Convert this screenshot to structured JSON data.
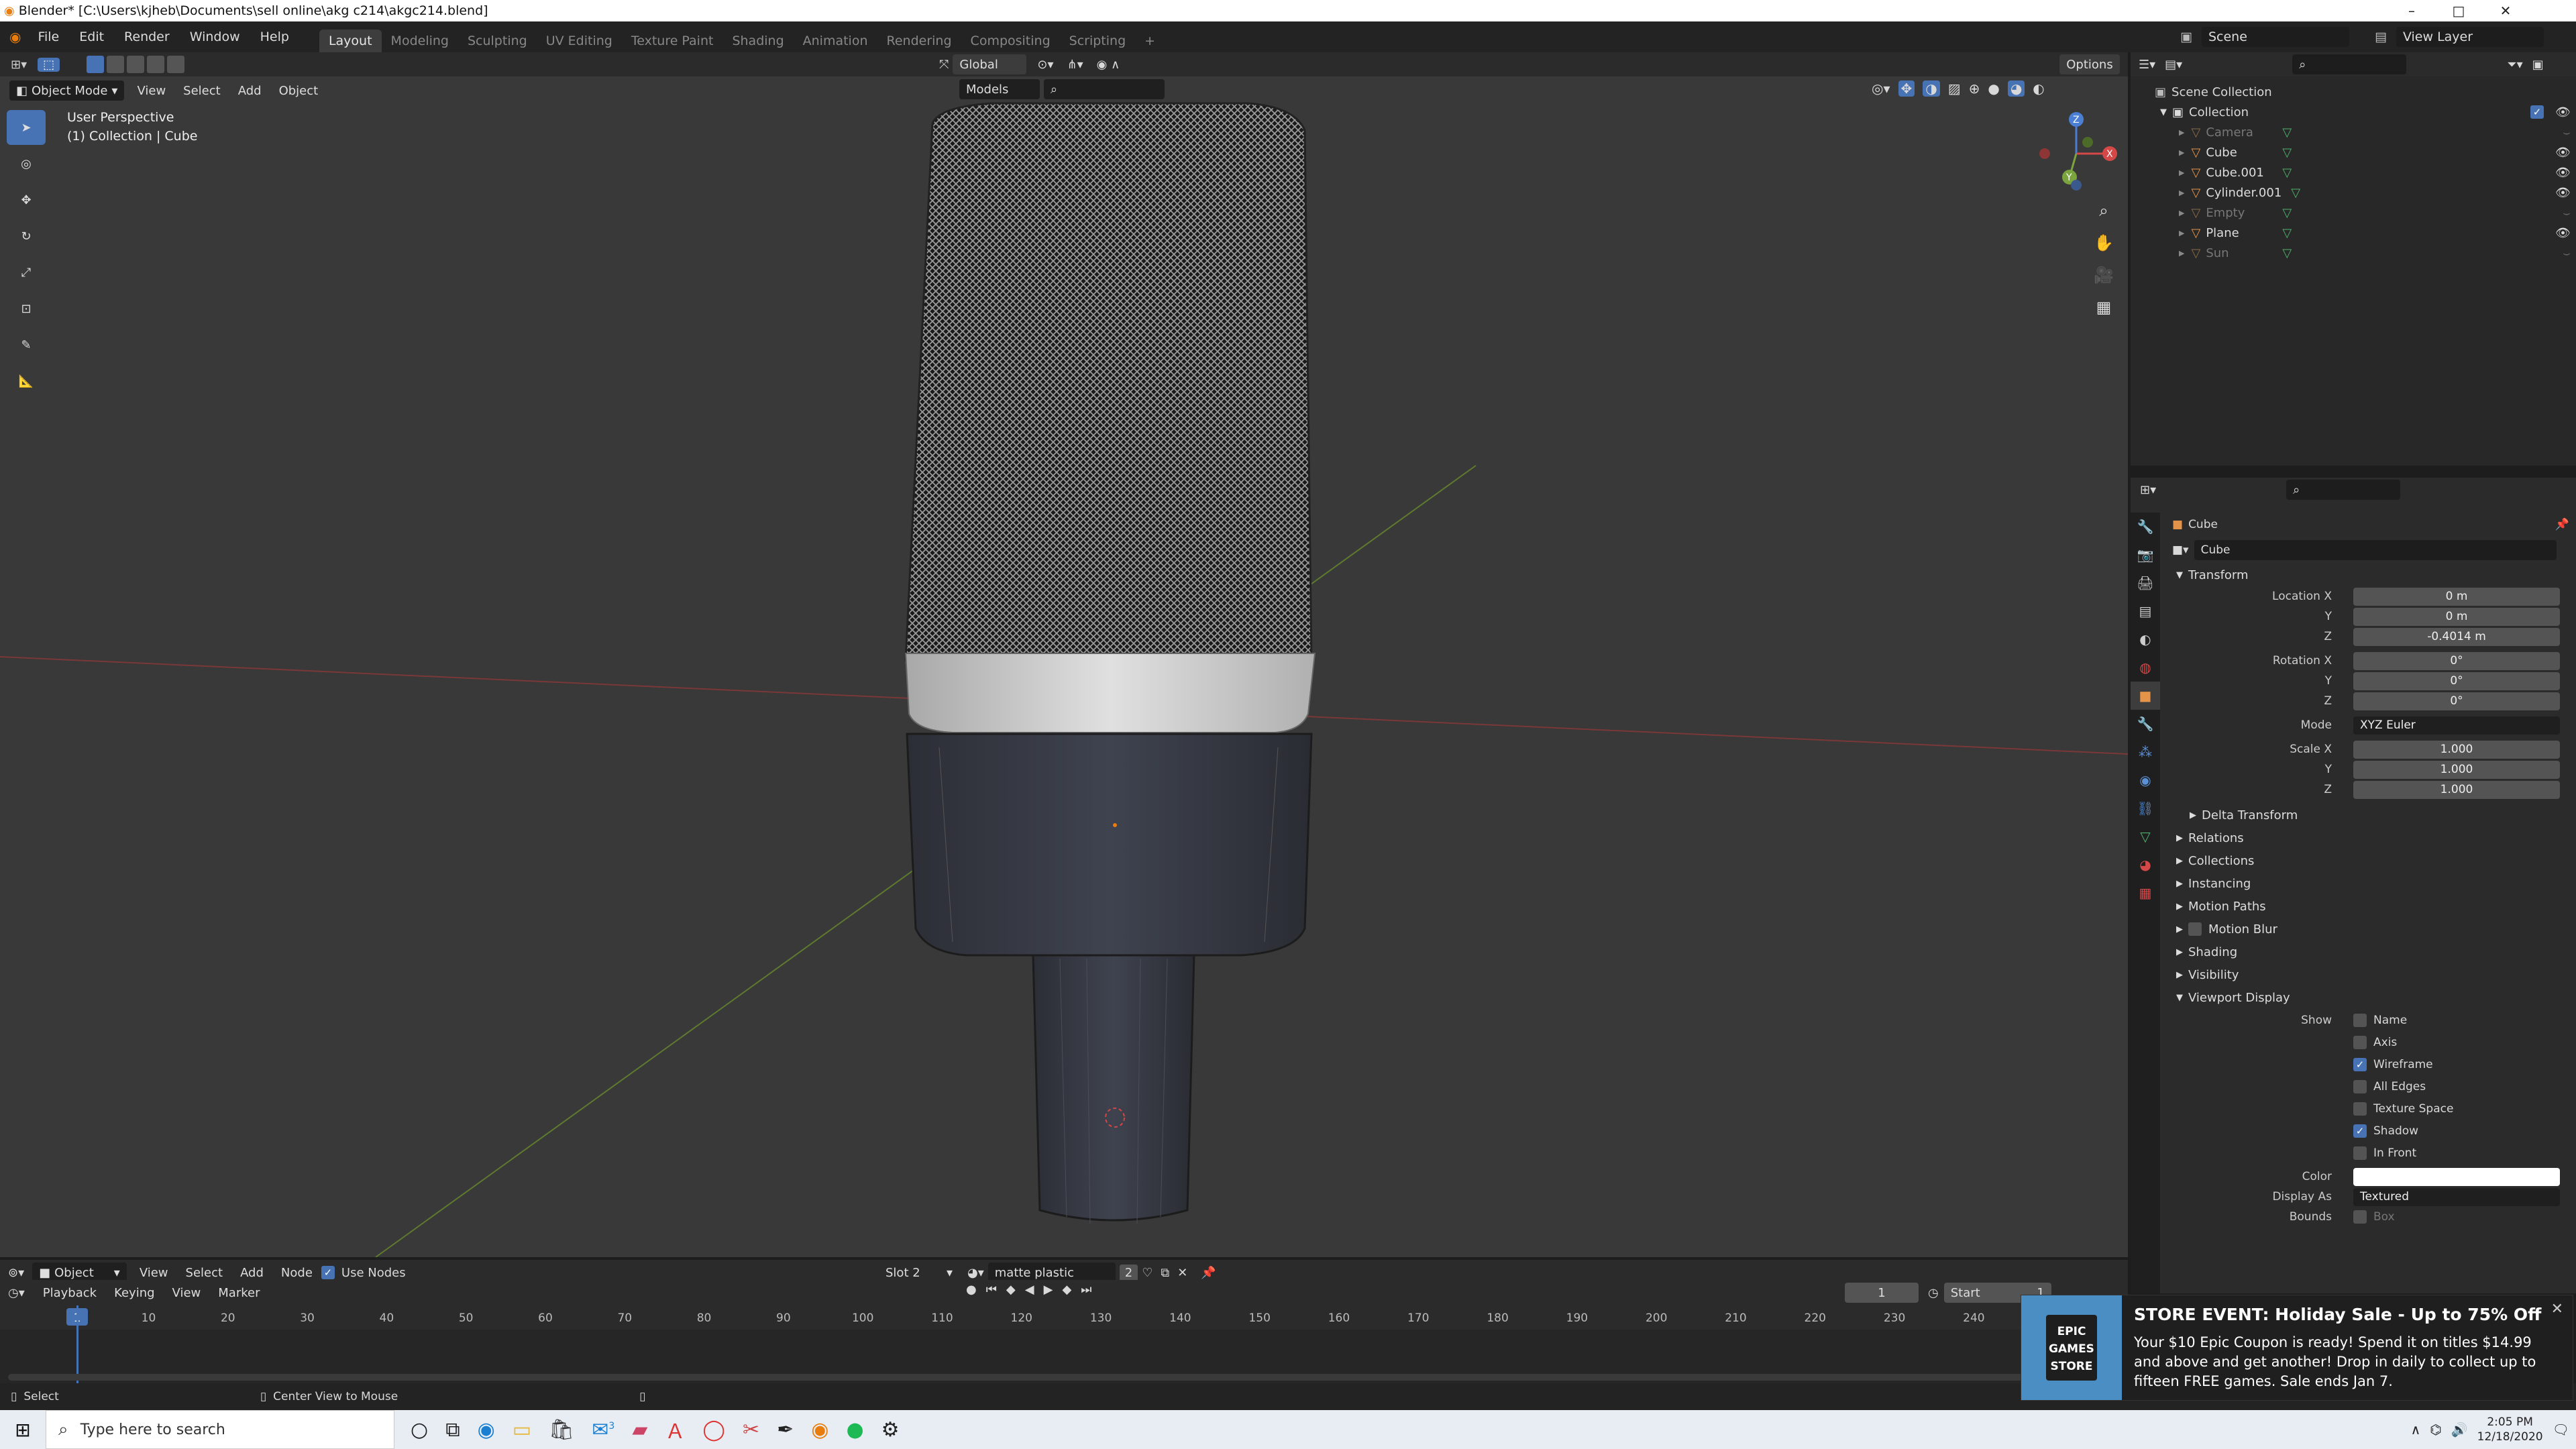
{
  "window": {
    "title": "Blender* [C:\\Users\\kjheb\\Documents\\sell online\\akg c214\\akgc214.blend]",
    "minimize": "–",
    "maximize": "□",
    "close": "✕"
  },
  "menus": [
    "File",
    "Edit",
    "Render",
    "Window",
    "Help"
  ],
  "workspaces": [
    "Layout",
    "Modeling",
    "Sculpting",
    "UV Editing",
    "Texture Paint",
    "Shading",
    "Animation",
    "Rendering",
    "Compositing",
    "Scripting"
  ],
  "active_workspace": "Layout",
  "add_workspace": "+",
  "scene": {
    "label": "Scene",
    "view_layer": "View Layer"
  },
  "tool_header": {
    "orientation": "Global",
    "options": "Options",
    "models": "Models"
  },
  "viewport_header": {
    "mode": "Object Mode",
    "view": "View",
    "select": "Select",
    "add": "Add",
    "object": "Object"
  },
  "viewport": {
    "perspective": "User Perspective",
    "collection": "(1) Collection | Cube"
  },
  "gizmo": {
    "x": "X",
    "y": "Y",
    "z": "Z"
  },
  "outliner": {
    "scene_collection": "Scene Collection",
    "collection": "Collection",
    "items": [
      {
        "name": "Camera",
        "type_icon": "camera-icon",
        "data_icon": "camera-data-icon",
        "visible": false,
        "color": "#8a6a4a"
      },
      {
        "name": "Cube",
        "type_icon": "mesh-object-icon",
        "data_icon": "mesh-data-icon",
        "visible": true,
        "color": "#e4934a"
      },
      {
        "name": "Cube.001",
        "type_icon": "mesh-object-icon",
        "data_icon": "mesh-data-icon",
        "visible": true,
        "color": "#e4934a"
      },
      {
        "name": "Cylinder.001",
        "type_icon": "mesh-object-icon",
        "data_icon": "mesh-data-icon",
        "visible": true,
        "color": "#e4934a"
      },
      {
        "name": "Empty",
        "type_icon": "empty-icon",
        "data_icon": "constraint-icon",
        "visible": false,
        "color": "#8a6a4a"
      },
      {
        "name": "Plane",
        "type_icon": "mesh-object-icon",
        "data_icon": "mesh-data-icon",
        "visible": true,
        "color": "#e4934a"
      },
      {
        "name": "Sun",
        "type_icon": "light-icon",
        "data_icon": "light-data-icon",
        "visible": false,
        "color": "#8a6a4a"
      }
    ]
  },
  "properties": {
    "object_name": "Cube",
    "object_field": "Cube",
    "transform": {
      "title": "Transform",
      "location": {
        "label": "Location X",
        "x": "0 m",
        "y": "0 m",
        "z": "-0.4014 m"
      },
      "rotation": {
        "label": "Rotation X",
        "x": "0°",
        "y": "0°",
        "z": "0°"
      },
      "mode": {
        "label": "Mode",
        "value": "XYZ Euler"
      },
      "scale": {
        "label": "Scale X",
        "x": "1.000",
        "y": "1.000",
        "z": "1.000"
      },
      "y_label": "Y",
      "z_label": "Z"
    },
    "delta_transform": "Delta Transform",
    "panels": [
      "Relations",
      "Collections",
      "Instancing",
      "Motion Paths",
      "Motion Blur",
      "Shading",
      "Visibility"
    ],
    "viewport_display": {
      "title": "Viewport Display",
      "show_label": "Show",
      "options": [
        {
          "label": "Name",
          "checked": false
        },
        {
          "label": "Axis",
          "checked": false
        },
        {
          "label": "Wireframe",
          "checked": true
        },
        {
          "label": "All Edges",
          "checked": false
        },
        {
          "label": "Texture Space",
          "checked": false
        },
        {
          "label": "Shadow",
          "checked": true
        },
        {
          "label": "In Front",
          "checked": false
        }
      ],
      "color_label": "Color",
      "display_as_label": "Display As",
      "display_as": "Textured",
      "bounds_label": "Bounds",
      "bounds_value": "Box"
    }
  },
  "shader_header": {
    "editor": "Object",
    "view": "View",
    "select": "Select",
    "add": "Add",
    "node": "Node",
    "use_nodes": "Use Nodes",
    "slot": "Slot 2",
    "material": "matte plastic",
    "users": "2"
  },
  "timeline": {
    "playback": "Playback",
    "keying": "Keying",
    "view": "View",
    "marker": "Marker",
    "current_frame": "1",
    "start_label": "Start",
    "start_value": "1",
    "ruler": [
      "1",
      "10",
      "20",
      "30",
      "40",
      "50",
      "60",
      "70",
      "80",
      "90",
      "100",
      "110",
      "120",
      "130",
      "140",
      "150",
      "160",
      "170",
      "180",
      "190",
      "200",
      "210",
      "220",
      "230",
      "240"
    ]
  },
  "status": {
    "select": "Select",
    "center": "Center View to Mouse"
  },
  "toast": {
    "store": "EPIC GAMES STORE",
    "title": "STORE EVENT: Holiday Sale - Up to 75% Off",
    "body": "Your $10 Epic Coupon is ready! Spend it on titles $14.99 and above and get another! Drop in daily to collect up to fifteen FREE games. Sale ends Jan 7."
  },
  "taskbar": {
    "search_placeholder": "Type here to search",
    "time": "2:05 PM",
    "date": "12/18/2020",
    "mail_badge": "3"
  }
}
